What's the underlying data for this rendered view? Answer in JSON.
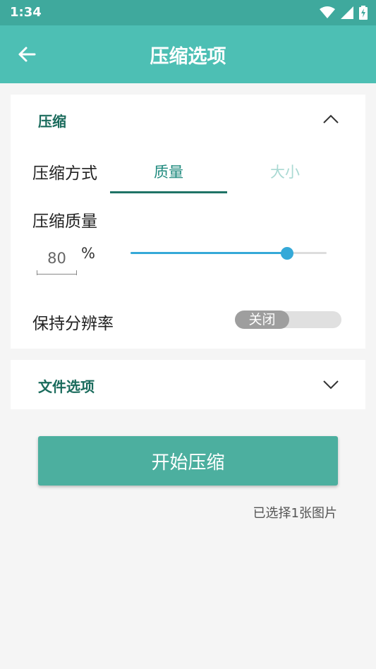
{
  "status_bar": {
    "time": "1:34"
  },
  "app_bar": {
    "title": "压缩选项"
  },
  "compress_section": {
    "title": "压缩",
    "method_label": "压缩方式",
    "tabs": [
      {
        "label": "质量",
        "selected": true
      },
      {
        "label": "大小",
        "selected": false
      }
    ],
    "quality_label": "压缩质量",
    "quality_value": "80",
    "quality_unit": "%",
    "quality_slider_fraction": 0.8,
    "keep_resolution_label": "保持分辨率",
    "keep_resolution_toggle": "关闭"
  },
  "file_section": {
    "title": "文件选项"
  },
  "start_button": {
    "label": "开始压缩"
  },
  "selected_count": "已选择1张图片",
  "colors": {
    "status_bar": "#3fa99d",
    "app_bar": "#4dbfb4",
    "accent_dark": "#1a6b5c",
    "slider": "#35a9d8",
    "button": "#4caf9f"
  }
}
